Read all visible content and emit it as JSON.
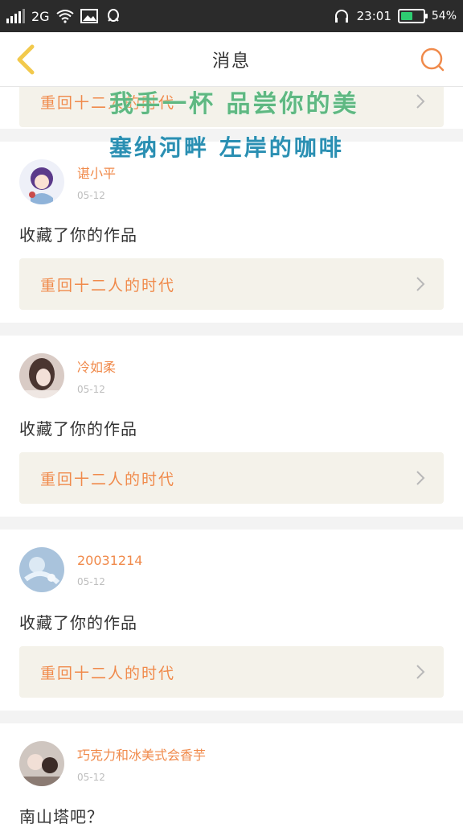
{
  "status_bar": {
    "network": "2G",
    "time": "23:01",
    "battery_pct": "54%",
    "battery_level": 0.54
  },
  "header": {
    "title": "消息"
  },
  "overlay": {
    "line1": "我手一杯 品尝你的美",
    "line2": "塞纳河畔 左岸的咖啡"
  },
  "top_card": {
    "link_text": "重回十二人的时代"
  },
  "messages": [
    {
      "user": "谌小平",
      "time": "05-12",
      "text": "收藏了你的作品",
      "link_text": "重回十二人的时代"
    },
    {
      "user": "冷如柔",
      "time": "05-12",
      "text": "收藏了你的作品",
      "link_text": "重回十二人的时代"
    },
    {
      "user": "20031214",
      "time": "05-12",
      "text": "收藏了你的作品",
      "link_text": "重回十二人的时代"
    },
    {
      "user": "巧克力和冰美式会香芋",
      "time": "05-12",
      "text": "南山塔吧？"
    }
  ],
  "colors": {
    "accent": "#f08a4b",
    "back_arrow": "#f2c94c",
    "battery_fill": "#2ecc71",
    "link_box_bg": "#f4f2ea"
  }
}
